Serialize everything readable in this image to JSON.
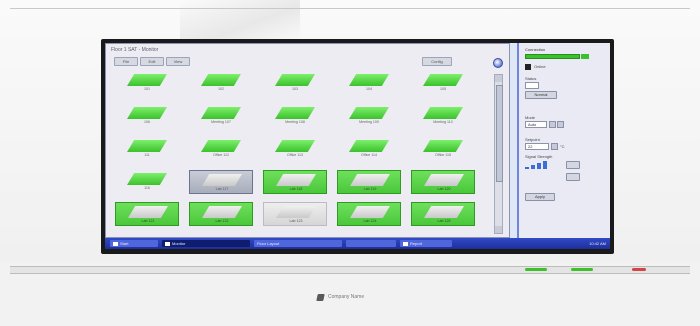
{
  "window": {
    "title": "Floor 1 SAT - Monitor",
    "toolbar": [
      "File",
      "Edit",
      "View",
      "Config"
    ]
  },
  "tiles": [
    [
      "101",
      "102",
      "103",
      "104",
      "105"
    ],
    [
      "106",
      "Meeting 107",
      "Meeting 108",
      "Meeting 109",
      "Meeting 110"
    ],
    [
      "111",
      "Office 112",
      "Office 113",
      "Office 114",
      "Office 115"
    ],
    [
      "116",
      "Lab 117",
      "Lab 118",
      "Lab 119",
      "Lab 120"
    ],
    [
      "Lab 121",
      "Lab 122",
      "Lab 123",
      "Lab 124",
      "Lab 125"
    ]
  ],
  "taskbar": {
    "items": [
      "Start",
      "Monitor",
      "Floor Layout",
      "",
      "Report"
    ],
    "clock": "10:42 AM"
  },
  "panel": {
    "header": "Connection",
    "online_label": "Online",
    "status_label": "Status",
    "status_value": "Normal",
    "mode_label": "Mode",
    "mode_value": "Auto",
    "setpoint_label": "Setpoint",
    "setpoint_value": "22",
    "setpoint_unit": "°C",
    "signal_label": "Signal Strength",
    "apply_label": "Apply"
  },
  "footer": {
    "brand": "Company Name"
  },
  "colors": {
    "ok": "#3cc12d",
    "taskbar": "#1d2f9a",
    "panel_accent": "#6e86e0"
  }
}
